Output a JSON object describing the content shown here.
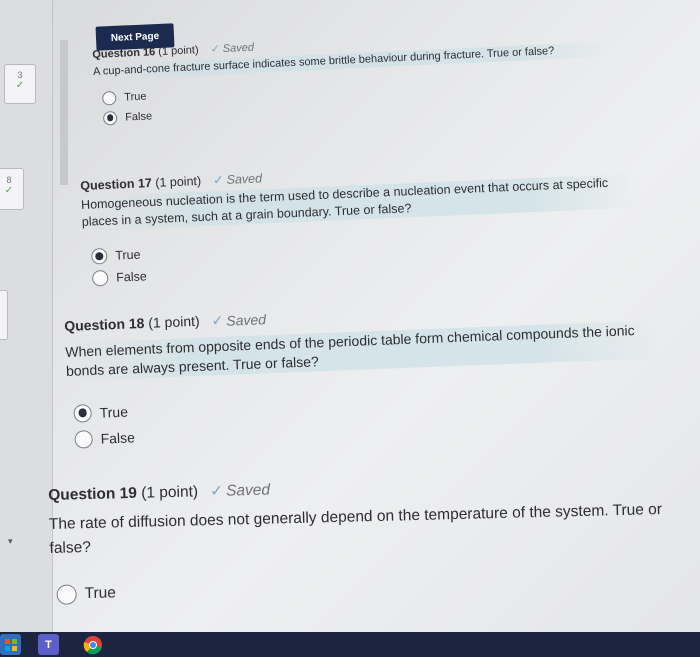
{
  "nav": {
    "next_page_label": "Next Page"
  },
  "rail": {
    "items": [
      {
        "number": "3",
        "check": "✓"
      },
      {
        "number": "8",
        "check": "✓"
      }
    ]
  },
  "questions": [
    {
      "title": "Question 16",
      "points": "(1 point)",
      "saved": "Saved",
      "text": "A cup-and-cone fracture surface indicates some brittle behaviour during fracture. True or false?",
      "options": [
        {
          "label": "True",
          "selected": false
        },
        {
          "label": "False",
          "selected": true
        }
      ]
    },
    {
      "title": "Question 17",
      "points": "(1 point)",
      "saved": "Saved",
      "text": "Homogeneous nucleation is the term used to describe a nucleation event that occurs at specific places in a system, such at a grain boundary. True or false?",
      "options": [
        {
          "label": "True",
          "selected": true
        },
        {
          "label": "False",
          "selected": false
        }
      ]
    },
    {
      "title": "Question 18",
      "points": "(1 point)",
      "saved": "Saved",
      "text": "When elements from opposite ends of the periodic table form chemical compounds the ionic bonds are always present. True or false?",
      "options": [
        {
          "label": "True",
          "selected": true
        },
        {
          "label": "False",
          "selected": false
        }
      ]
    },
    {
      "title": "Question 19",
      "points": "(1 point)",
      "saved": "Saved",
      "text": "The rate of diffusion does not generally depend on the temperature of the system. True or false?",
      "options": [
        {
          "label": "True",
          "selected": false
        }
      ]
    }
  ],
  "taskbar": {
    "icons": [
      {
        "name": "store-icon",
        "color": "#2f6fc0"
      },
      {
        "name": "teams-icon",
        "color": "#5b5fc7",
        "glyph": "T"
      },
      {
        "name": "chrome-icon",
        "color": "#e0b22a"
      }
    ]
  }
}
